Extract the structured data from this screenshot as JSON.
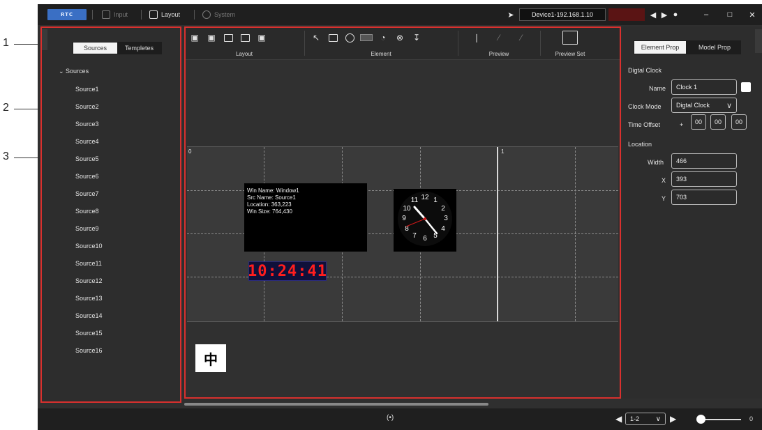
{
  "callouts": [
    "1",
    "2",
    "3"
  ],
  "titlebar": {
    "logo_text": "RTC",
    "menu": [
      {
        "label": "Input",
        "icon": "input-icon",
        "enabled": false
      },
      {
        "label": "Layout",
        "icon": "layout-icon",
        "enabled": true
      },
      {
        "label": "System",
        "icon": "system-icon",
        "enabled": false
      }
    ],
    "device": "Device1-192.168.1.10",
    "status_color": "#5a1414"
  },
  "left_panel": {
    "tabs": [
      "Sources",
      "Templetes"
    ],
    "active_tab": "Sources",
    "tree_header": "Sources",
    "sources": [
      "Source1",
      "Source2",
      "Source3",
      "Source4",
      "Source5",
      "Source6",
      "Source7",
      "Source8",
      "Source9",
      "Source10",
      "Source11",
      "Source12",
      "Source13",
      "Source14",
      "Source15",
      "Source16"
    ]
  },
  "ribbon": {
    "groups": [
      "Layout",
      "Element",
      "Preview",
      "Preview Set"
    ]
  },
  "canvas": {
    "screen_labels": [
      "0",
      "1"
    ],
    "window": {
      "lines": [
        "Win Name:  Window1",
        "Src Name:  Source1",
        "Location:  363,223",
        "Win Size:  764,430"
      ]
    },
    "clock_numbers": [
      "12",
      "1",
      "2",
      "3",
      "4",
      "5",
      "6",
      "7",
      "8",
      "9",
      "10",
      "11"
    ],
    "digital_time": "10:24:41",
    "digital_color": "#ff1e1e",
    "ime_char": "中"
  },
  "right_panel": {
    "tabs": [
      "Element Prop",
      "Model Prop"
    ],
    "active_tab": "Element Prop",
    "section_title": "Digtal Clock",
    "name_label": "Name",
    "name_value": "Clock 1",
    "clock_mode_label": "Clock Mode",
    "clock_mode_value": "Digtal Clock",
    "time_offset_label": "Time Offset",
    "time_offset_sign": "+",
    "time_offset": [
      "00",
      "00",
      "00"
    ],
    "location_title": "Location",
    "width_label": "Width",
    "width_value": "466",
    "x_label": "X",
    "x_value": "393",
    "y_label": "Y",
    "y_value": "703"
  },
  "statusbar": {
    "broadcast_icon": "(•)",
    "page_value": "1-2",
    "zoom_value": "0"
  }
}
